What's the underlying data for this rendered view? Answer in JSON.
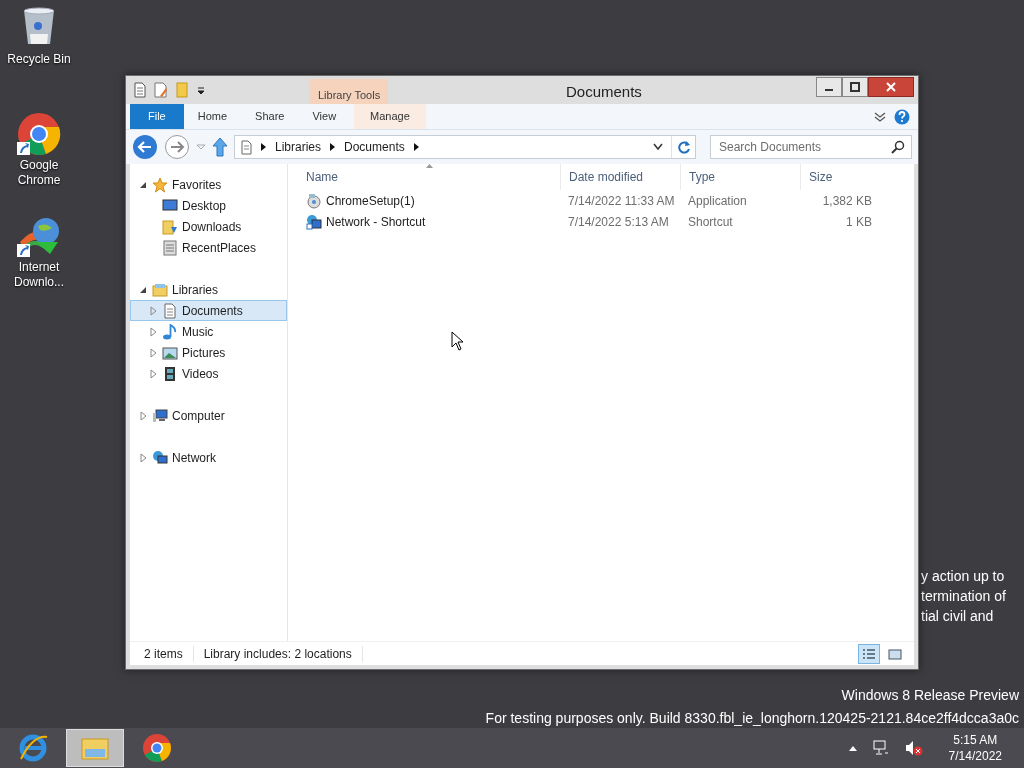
{
  "desktop_icons": [
    {
      "label": "Recycle Bin",
      "shortcut": false
    },
    {
      "label": "Google Chrome",
      "shortcut": true
    },
    {
      "label": "Internet Downlo...",
      "shortcut": true
    }
  ],
  "window": {
    "title": "Documents",
    "contextual_group": "Library Tools",
    "ribbon_tabs": [
      {
        "label": "File",
        "kind": "file"
      },
      {
        "label": "Home",
        "kind": "tab"
      },
      {
        "label": "Share",
        "kind": "tab"
      },
      {
        "label": "View",
        "kind": "tab"
      },
      {
        "label": "Manage",
        "kind": "contextual"
      }
    ],
    "address": {
      "segments": [
        "Libraries",
        "Documents"
      ]
    },
    "search": {
      "placeholder": "Search Documents"
    },
    "nav_tree": [
      {
        "label": "Favorites",
        "expanded": true,
        "selected": false,
        "children": [
          {
            "label": "Desktop",
            "selected": false
          },
          {
            "label": "Downloads",
            "selected": false
          },
          {
            "label": "RecentPlaces",
            "selected": false
          }
        ]
      },
      {
        "label": "Libraries",
        "expanded": true,
        "selected": false,
        "children": [
          {
            "label": "Documents",
            "expanded": false,
            "selected": true
          },
          {
            "label": "Music",
            "expanded": false,
            "selected": false
          },
          {
            "label": "Pictures",
            "expanded": false,
            "selected": false
          },
          {
            "label": "Videos",
            "expanded": false,
            "selected": false
          }
        ]
      },
      {
        "label": "Computer",
        "expanded": false,
        "selected": false
      },
      {
        "label": "Network",
        "expanded": false,
        "selected": false
      }
    ],
    "columns": [
      "Name",
      "Date modified",
      "Type",
      "Size"
    ],
    "rows": [
      {
        "name": "ChromeSetup(1)",
        "date_modified": "7/14/2022 11:33 AM",
        "type": "Application",
        "size": "1,382 KB"
      },
      {
        "name": "Network - Shortcut",
        "date_modified": "7/14/2022 5:13 AM",
        "type": "Shortcut",
        "size": "1 KB"
      }
    ],
    "status_bar": [
      "2 items",
      "Library includes: 2 locations"
    ],
    "view_buttons": [
      {
        "selected": true
      },
      {
        "selected": false
      }
    ]
  },
  "background_text": [
    "y action up to",
    "termination of",
    "tial civil and"
  ],
  "watermark": [
    "Windows 8 Release Preview",
    "For testing purposes only. Build 8330.fbl_ie_longhorn.120425-2121.84ce2ff4dcca3a0c"
  ],
  "taskbar": {
    "apps": [
      {
        "selected": false
      },
      {
        "selected": true
      },
      {
        "selected": false
      }
    ],
    "time": "5:15 AM",
    "date": "7/14/2022"
  }
}
